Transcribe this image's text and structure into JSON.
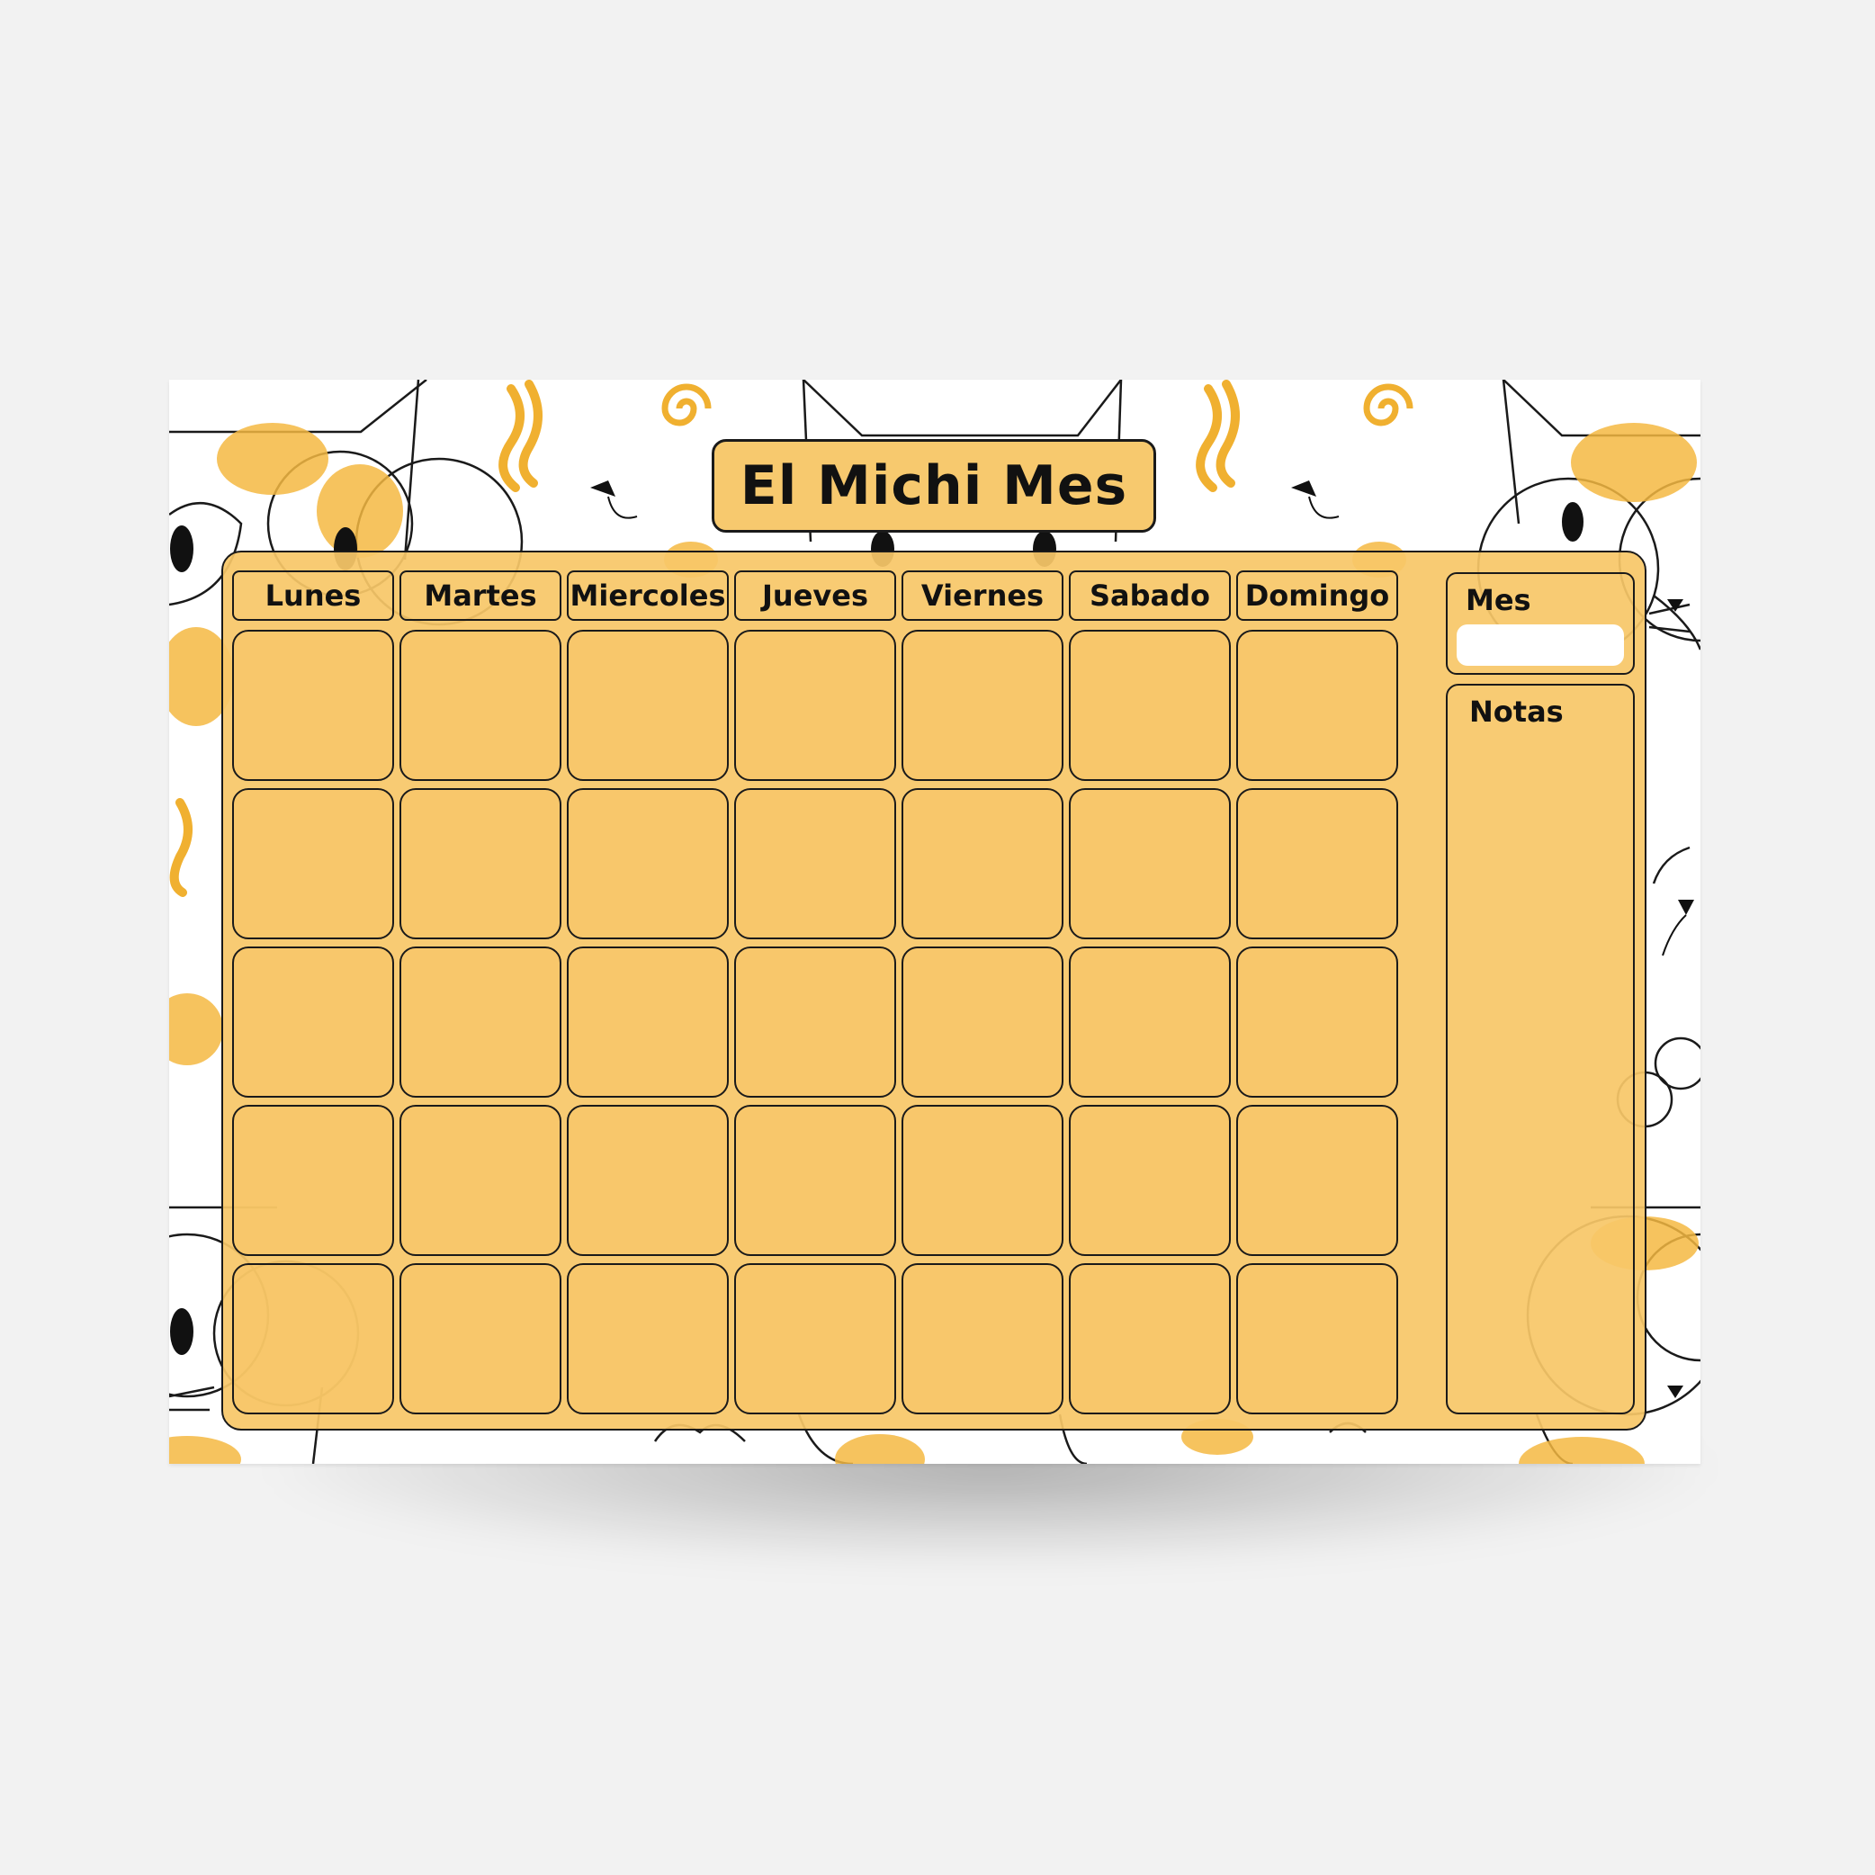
{
  "title": "El Michi Mes",
  "weekdays": [
    "Lunes",
    "Martes",
    "Miercoles",
    "Jueves",
    "Viernes",
    "Sabado",
    "Domingo"
  ],
  "grid": {
    "rows": 5,
    "columns": 7
  },
  "side_panel": {
    "month_label": "Mes",
    "month_value": "",
    "notes_label": "Notas"
  },
  "colors": {
    "accent": "#f7c96e",
    "outline": "#1a1a1a",
    "background": "#f2f2f2",
    "sheet": "#ffffff"
  },
  "icons": [
    "cat-face-icon",
    "cat-nose-icon",
    "squiggle-icon",
    "spiral-icon",
    "paw-blob-icon"
  ]
}
